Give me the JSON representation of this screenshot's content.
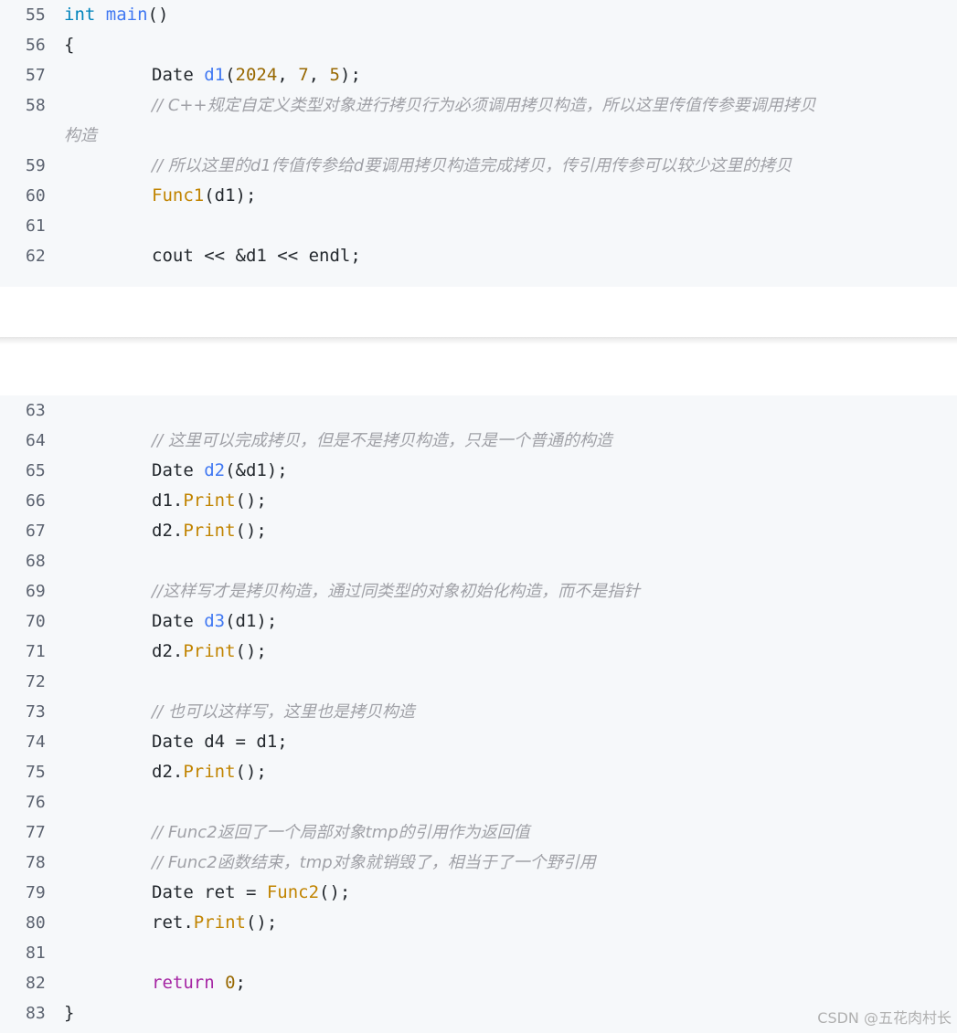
{
  "block1": {
    "lines": [
      {
        "n": "55",
        "parts": [
          {
            "t": "int ",
            "c": "ty"
          },
          {
            "t": "main",
            "c": "fn"
          },
          {
            "t": "()",
            "c": "plain"
          }
        ]
      },
      {
        "n": "56",
        "parts": [
          {
            "t": "{",
            "c": "plain"
          }
        ]
      },
      {
        "n": "57",
        "parts": [
          {
            "t": "Date ",
            "c": "plain"
          },
          {
            "t": "d1",
            "c": "fn"
          },
          {
            "t": "(",
            "c": "plain"
          },
          {
            "t": "2024",
            "c": "num"
          },
          {
            "t": ", ",
            "c": "plain"
          },
          {
            "t": "7",
            "c": "num"
          },
          {
            "t": ", ",
            "c": "plain"
          },
          {
            "t": "5",
            "c": "num"
          },
          {
            "t": ");",
            "c": "plain"
          }
        ],
        "indent": true
      },
      {
        "n": "58",
        "comment": "// C++规定自定义类型对象进行拷贝行为必须调用拷贝构造，所以这里传值传参要调用拷贝",
        "wrap": "构造",
        "indent": true
      },
      {
        "n": "59",
        "comment": "// 所以这里的d1传值传参给d要调用拷贝构造完成拷贝，传引用传参可以较少这里的拷贝",
        "indent": true
      },
      {
        "n": "60",
        "parts": [
          {
            "t": "Func1",
            "c": "call"
          },
          {
            "t": "(d1);",
            "c": "plain"
          }
        ],
        "indent": true
      },
      {
        "n": "61",
        "parts": []
      },
      {
        "n": "62",
        "parts": [
          {
            "t": "cout << &d1 << endl;",
            "c": "plain"
          }
        ],
        "indent": true
      }
    ]
  },
  "block2": {
    "lines": [
      {
        "n": "63",
        "parts": []
      },
      {
        "n": "64",
        "comment": "// 这里可以完成拷贝，但是不是拷贝构造，只是一个普通的构造",
        "indent": true
      },
      {
        "n": "65",
        "parts": [
          {
            "t": "Date ",
            "c": "plain"
          },
          {
            "t": "d2",
            "c": "fn"
          },
          {
            "t": "(&d1);",
            "c": "plain"
          }
        ],
        "indent": true
      },
      {
        "n": "66",
        "parts": [
          {
            "t": "d1.",
            "c": "plain"
          },
          {
            "t": "Print",
            "c": "call"
          },
          {
            "t": "();",
            "c": "plain"
          }
        ],
        "indent": true
      },
      {
        "n": "67",
        "parts": [
          {
            "t": "d2.",
            "c": "plain"
          },
          {
            "t": "Print",
            "c": "call"
          },
          {
            "t": "();",
            "c": "plain"
          }
        ],
        "indent": true
      },
      {
        "n": "68",
        "parts": []
      },
      {
        "n": "69",
        "comment": "//这样写才是拷贝构造，通过同类型的对象初始化构造，而不是指针",
        "indent": true
      },
      {
        "n": "70",
        "parts": [
          {
            "t": "Date ",
            "c": "plain"
          },
          {
            "t": "d3",
            "c": "fn"
          },
          {
            "t": "(d1);",
            "c": "plain"
          }
        ],
        "indent": true
      },
      {
        "n": "71",
        "parts": [
          {
            "t": "d2.",
            "c": "plain"
          },
          {
            "t": "Print",
            "c": "call"
          },
          {
            "t": "();",
            "c": "plain"
          }
        ],
        "indent": true
      },
      {
        "n": "72",
        "parts": []
      },
      {
        "n": "73",
        "comment": "// 也可以这样写，这里也是拷贝构造",
        "indent": true
      },
      {
        "n": "74",
        "parts": [
          {
            "t": "Date d4 = d1;",
            "c": "plain"
          }
        ],
        "indent": true
      },
      {
        "n": "75",
        "parts": [
          {
            "t": "d2.",
            "c": "plain"
          },
          {
            "t": "Print",
            "c": "call"
          },
          {
            "t": "();",
            "c": "plain"
          }
        ],
        "indent": true
      },
      {
        "n": "76",
        "parts": []
      },
      {
        "n": "77",
        "comment": "// Func2返回了一个局部对象tmp的引用作为返回值",
        "indent": true
      },
      {
        "n": "78",
        "comment": "// Func2函数结束，tmp对象就销毁了，相当于了一个野引用",
        "indent": true
      },
      {
        "n": "79",
        "parts": [
          {
            "t": "Date ret = ",
            "c": "plain"
          },
          {
            "t": "Func2",
            "c": "call"
          },
          {
            "t": "();",
            "c": "plain"
          }
        ],
        "indent": true
      },
      {
        "n": "80",
        "parts": [
          {
            "t": "ret.",
            "c": "plain"
          },
          {
            "t": "Print",
            "c": "call"
          },
          {
            "t": "();",
            "c": "plain"
          }
        ],
        "indent": true
      },
      {
        "n": "81",
        "parts": []
      },
      {
        "n": "82",
        "parts": [
          {
            "t": "return ",
            "c": "kw"
          },
          {
            "t": "0",
            "c": "num"
          },
          {
            "t": ";",
            "c": "plain"
          }
        ],
        "indent": true
      },
      {
        "n": "83",
        "parts": [
          {
            "t": "}",
            "c": "plain"
          }
        ]
      }
    ]
  },
  "watermark": "CSDN @五花肉村长"
}
